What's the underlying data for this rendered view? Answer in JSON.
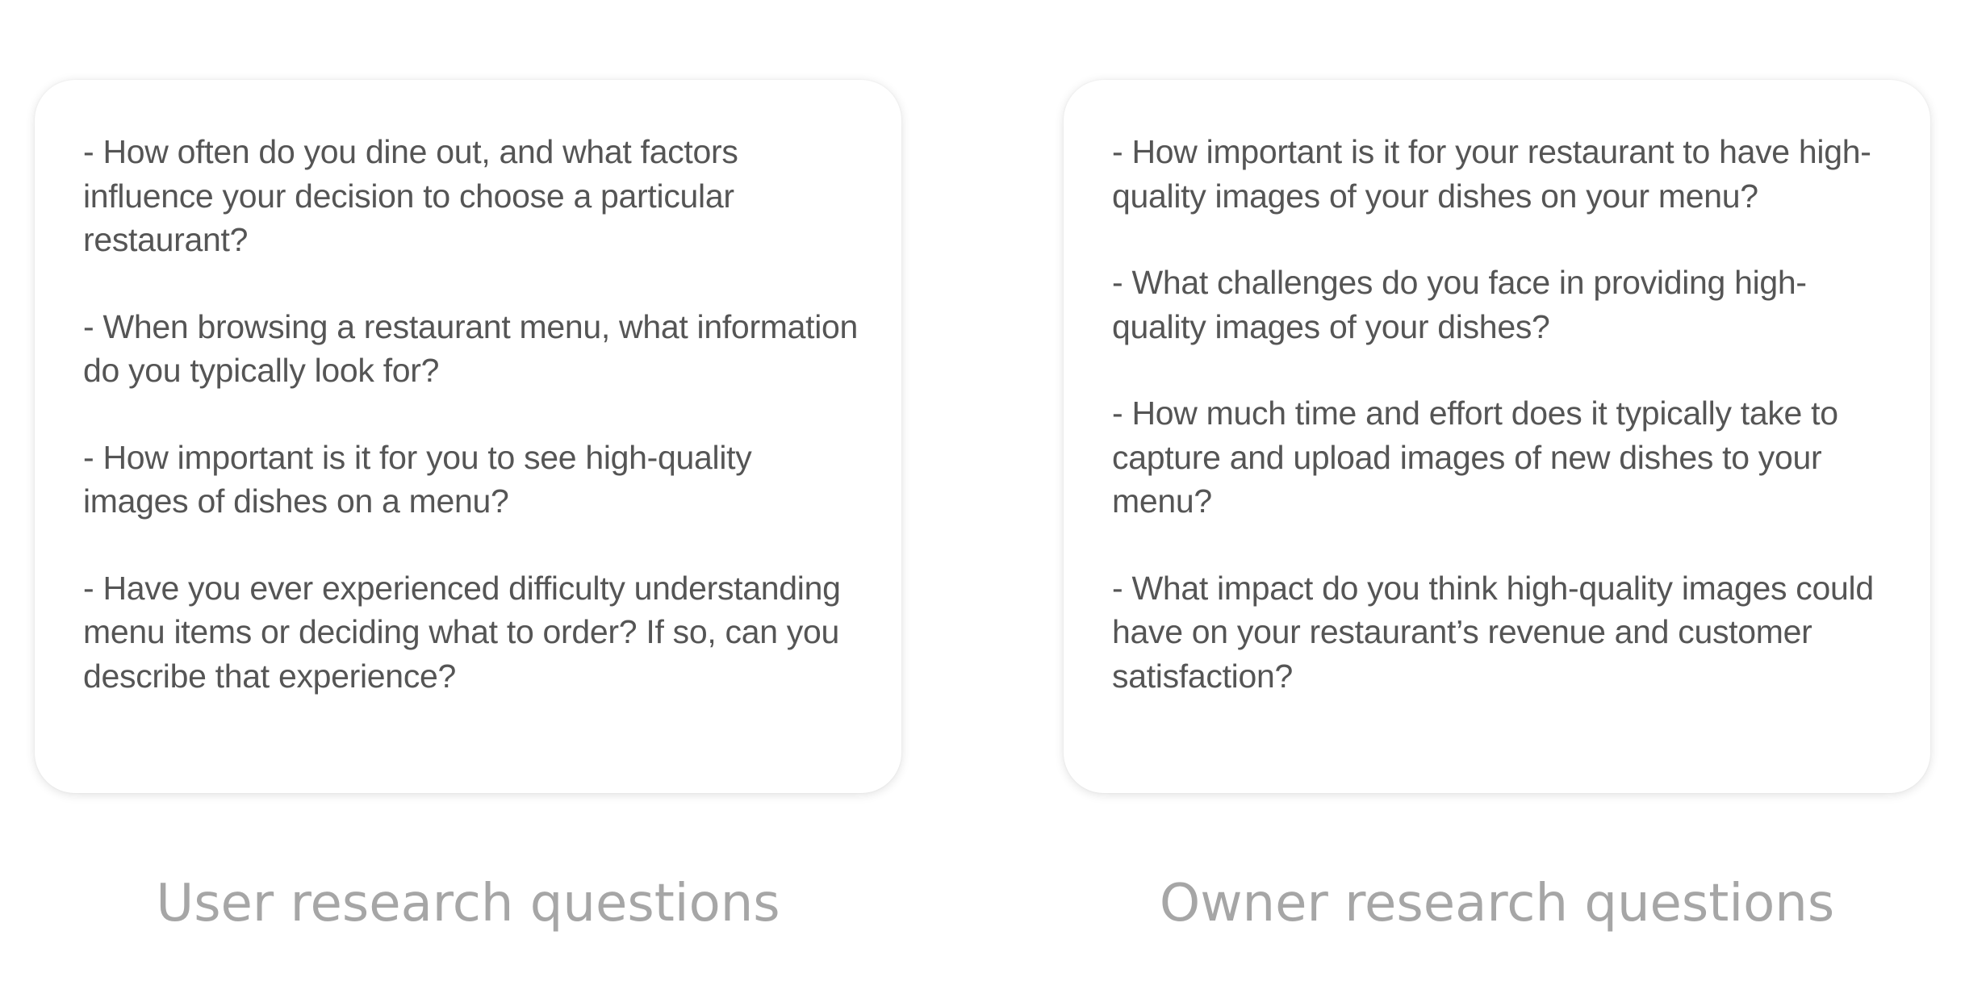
{
  "panels": [
    {
      "caption": "User research questions",
      "questions": [
        "- How often do you dine out, and what factors influence your decision to choose a particular restaurant?",
        "- When browsing a restaurant menu, what information do you typically look for?",
        "- How important is it for you to see high-quality images of dishes on a menu?",
        "- Have you ever experienced difficulty understanding menu items or deciding what to order? If so, can you describe that experience?"
      ]
    },
    {
      "caption": "Owner research questions",
      "questions": [
        "- How important is it for your restaurant to have high-quality images of your dishes on your menu?",
        "- What challenges do you face in providing high-quality images of your dishes?",
        "- How much time and effort does it typically take to capture and upload images of new dishes to your menu?",
        "- What impact do you think high-quality images could have on your restaurant’s revenue and customer satisfaction?"
      ]
    }
  ],
  "colors": {
    "background": "#ffffff",
    "question_text": "#555555",
    "caption_text": "#a6a6a6"
  }
}
